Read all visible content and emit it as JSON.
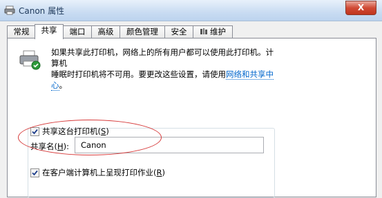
{
  "window": {
    "title": "Canon 属性",
    "close_glyph": "X"
  },
  "tabs": [
    {
      "label": "常规"
    },
    {
      "label": "共享"
    },
    {
      "label": "端口"
    },
    {
      "label": "高级"
    },
    {
      "label": "颜色管理"
    },
    {
      "label": "安全"
    },
    {
      "label": "维护"
    }
  ],
  "share_tab": {
    "description_line1": "如果共享此打印机，网络上的所有用户都可以使用此打印机。计算机",
    "description_line2": "睡眠时打印机将不可用。要更改这些设置，请使用",
    "network_link": "网络和共享中心",
    "description_end": "。",
    "share_printer_checkbox": {
      "label": "共享这台打印机",
      "accel": "S",
      "checked": true
    },
    "share_name": {
      "label": "共享名",
      "accel": "H",
      "value": "Canon"
    },
    "render_on_client_checkbox": {
      "label": "在客户端计算机上呈现打印作业",
      "accel": "R",
      "checked": true
    }
  },
  "colors": {
    "link": "#0066cc",
    "annotation_ellipse": "#d63a3a"
  }
}
